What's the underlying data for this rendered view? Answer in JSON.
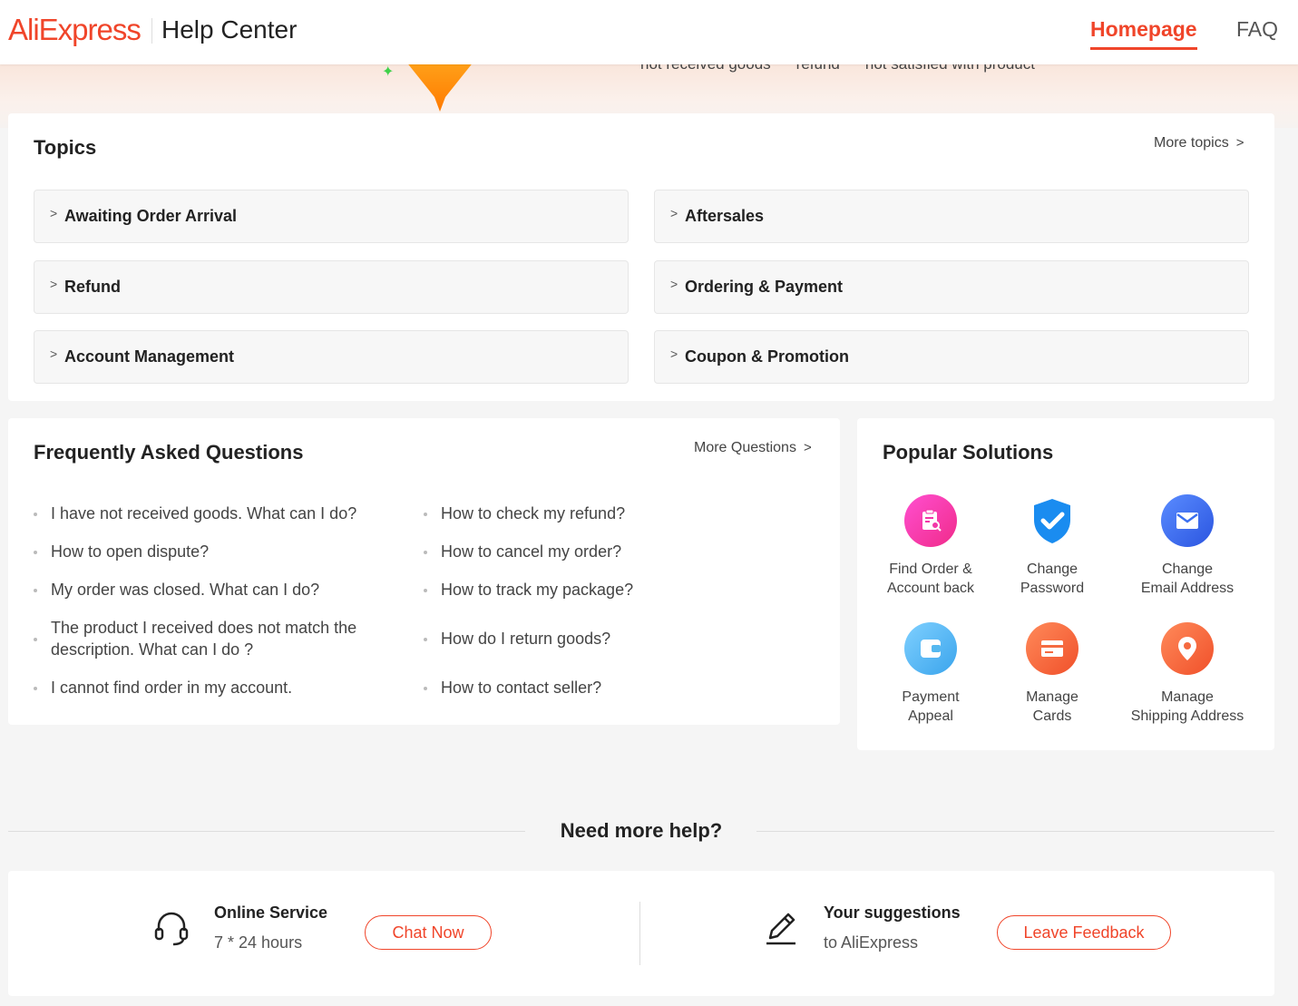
{
  "header": {
    "logo": "AliExpress",
    "title": "Help Center",
    "nav": {
      "home": "Homepage",
      "faq": "FAQ"
    }
  },
  "banner": {
    "tags": [
      "not received goods",
      "refund",
      "not satisfied with product"
    ]
  },
  "topics": {
    "title": "Topics",
    "more": "More topics",
    "items": [
      "Awaiting Order Arrival",
      "Aftersales",
      "Refund",
      "Ordering & Payment",
      "Account Management",
      "Coupon & Promotion"
    ]
  },
  "faq": {
    "title": "Frequently Asked Questions",
    "more": "More Questions",
    "left": [
      "I have not received goods. What can I do?",
      "How to open dispute?",
      "My order was closed. What can I do?",
      "The product I received does not match the description. What can I do ?",
      "I cannot find order in my account."
    ],
    "right": [
      "How to check my refund?",
      "How to cancel my order?",
      "How to track my package?",
      "How do I return goods?",
      "How to contact seller?"
    ]
  },
  "popular": {
    "title": "Popular Solutions",
    "items": [
      {
        "l1": "Find Order &",
        "l2": "Account back",
        "icon": "clipboard-search-icon",
        "color": "#f237a8"
      },
      {
        "l1": "Change",
        "l2": "Password",
        "icon": "shield-check-icon",
        "color": "#1a8cf0"
      },
      {
        "l1": "Change",
        "l2": "Email Address",
        "icon": "envelope-icon",
        "color": "#3a6ff0"
      },
      {
        "l1": "Payment",
        "l2": "Appeal",
        "icon": "wallet-icon",
        "color": "#55b8f0"
      },
      {
        "l1": "Manage",
        "l2": "Cards",
        "icon": "card-icon",
        "color": "#f56a40"
      },
      {
        "l1": "Manage",
        "l2": "Shipping Address",
        "icon": "location-pin-icon",
        "color": "#f56a40"
      }
    ]
  },
  "help": {
    "title": "Need more help?",
    "online_title": "Online Service",
    "online_sub": "7 * 24 hours",
    "chat": "Chat Now",
    "sugg_title": "Your suggestions",
    "sugg_sub": "to AliExpress",
    "feedback": "Leave Feedback"
  },
  "colors": {
    "brand": "#f0452a"
  }
}
